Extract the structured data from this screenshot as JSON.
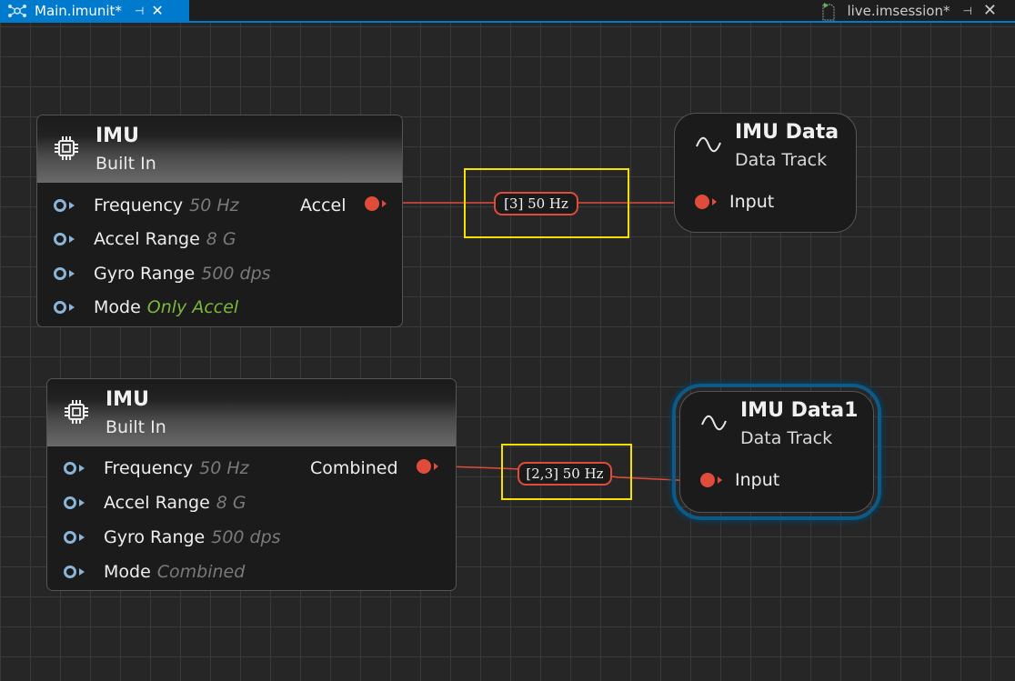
{
  "tabs": {
    "active": {
      "label": "Main.imunit*",
      "icon": "network-icon",
      "pin_glyph": "⊣",
      "close_glyph": "✕"
    },
    "inactive": {
      "label": "live.imsession*",
      "icon": "document-icon",
      "pin_glyph": "⊣",
      "close_glyph": "✕"
    }
  },
  "nodes": [
    {
      "title": "IMU",
      "subtitle": "Built In",
      "icon": "chip-icon",
      "params": [
        {
          "label": "Frequency",
          "value": "50 Hz"
        },
        {
          "label": "Accel Range",
          "value": "8 G"
        },
        {
          "label": "Gyro Range",
          "value": "500 dps"
        },
        {
          "label": "Mode",
          "value": "Only Accel"
        }
      ],
      "output": "Accel"
    },
    {
      "title": "IMU",
      "subtitle": "Built In",
      "icon": "chip-icon",
      "params": [
        {
          "label": "Frequency",
          "value": "50 Hz"
        },
        {
          "label": "Accel Range",
          "value": "8 G"
        },
        {
          "label": "Gyro Range",
          "value": "500 dps"
        },
        {
          "label": "Mode",
          "value": "Combined"
        }
      ],
      "output": "Combined"
    }
  ],
  "data_nodes": [
    {
      "title": "IMU Data",
      "subtitle": "Data Track",
      "input": "Input",
      "icon": "wave-icon"
    },
    {
      "title": "IMU Data1",
      "subtitle": "Data Track",
      "input": "Input",
      "icon": "wave-icon",
      "selected": true
    }
  ],
  "connections": [
    {
      "label": "[3] 50 Hz"
    },
    {
      "label": "[2,3] 50 Hz"
    }
  ],
  "colors": {
    "accent": "#007acc",
    "wire": "#e04c3c",
    "highlight": "#f5e000",
    "mode_active": "#7cb83d",
    "selection": "#0e5a86"
  }
}
